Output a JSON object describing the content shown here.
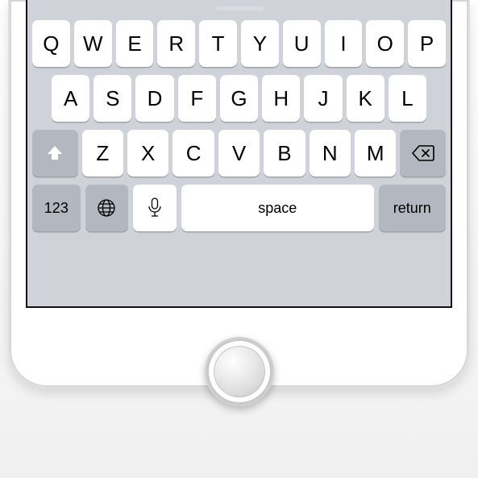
{
  "keyboard": {
    "rows": {
      "r1": [
        "Q",
        "W",
        "E",
        "R",
        "T",
        "Y",
        "U",
        "I",
        "O",
        "P"
      ],
      "r2": [
        "A",
        "S",
        "D",
        "F",
        "G",
        "H",
        "J",
        "K",
        "L"
      ],
      "r3": [
        "Z",
        "X",
        "C",
        "V",
        "B",
        "N",
        "M"
      ]
    },
    "fn": {
      "numsym": "123",
      "space": "space",
      "return": "return"
    }
  }
}
